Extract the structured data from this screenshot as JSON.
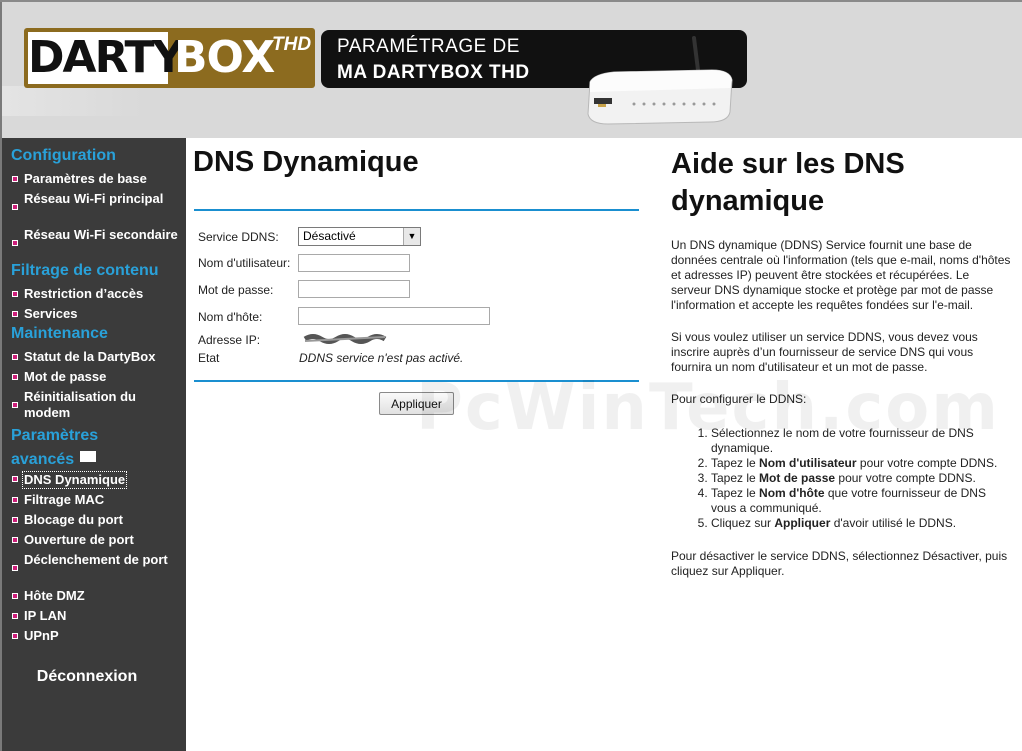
{
  "header": {
    "logo_brand": "DARTY",
    "logo_box": "BOX",
    "logo_thd": "THD",
    "banner_line1": "PARAMÉTRAGE DE",
    "banner_line2": "MA DARTYBOX THD"
  },
  "sidebar": {
    "sections": [
      {
        "title": "Configuration",
        "items": [
          "Paramètres de base",
          "Réseau Wi-Fi principal",
          "Réseau Wi-Fi secondaire"
        ]
      },
      {
        "title": "Filtrage de contenu",
        "items": [
          "Restriction d’accès",
          "Services"
        ]
      },
      {
        "title": "Maintenance",
        "items": [
          "Statut de la DartyBox",
          "Mot de passe",
          "Réinitialisation du modem"
        ]
      },
      {
        "title": "Paramètres avancés",
        "items": [
          "DNS Dynamique",
          "Filtrage MAC",
          "Blocage du port",
          "Ouverture de port",
          "Déclenchement de port",
          "Hôte DMZ",
          "IP LAN",
          "UPnP"
        ]
      }
    ],
    "active_item": "DNS Dynamique",
    "logout": "Déconnexion"
  },
  "main": {
    "title": "DNS Dynamique",
    "form": {
      "service_label": "Service DDNS:",
      "service_value": "Désactivé",
      "user_label": "Nom d'utilisateur:",
      "user_value": "",
      "pass_label": "Mot de passe:",
      "pass_value": "",
      "host_label": "Nom d'hôte:",
      "host_value": "",
      "ip_label": "Adresse IP:",
      "state_label": "Etat",
      "state_value": "DDNS service n'est pas activé.",
      "apply_button": "Appliquer"
    }
  },
  "help": {
    "title": "Aide sur les DNS dynamique",
    "p1": "Un DNS dynamique (DDNS) Service fournit une base de données centrale où l'information (tels que e-mail, noms d'hôtes et adresses IP) peuvent être stockées et récupérées. Le serveur DNS dynamique stocke et protège par mot de passe l'information et accepte les requêtes fondées sur l'e-mail.",
    "p2": "Si vous voulez utiliser un service DDNS, vous devez vous inscrire auprès d’un fournisseur de service DNS qui vous fournira un nom d'utilisateur et un mot de passe.",
    "p3": "Pour configurer le DDNS:",
    "steps": [
      {
        "pre": "Sélectionnez le nom de votre fournisseur de DNS dynamique.",
        "bold": "",
        "post": ""
      },
      {
        "pre": "Tapez le ",
        "bold": "Nom d'utilisateur",
        "post": " pour votre compte DDNS."
      },
      {
        "pre": "Tapez le ",
        "bold": "Mot de passe",
        "post": " pour votre compte DDNS."
      },
      {
        "pre": "Tapez le ",
        "bold": "Nom d'hôte",
        "post": " que votre fournisseur de DNS vous a communiqué."
      },
      {
        "pre": "Cliquez sur ",
        "bold": "Appliquer",
        "post": " d'avoir utilisé le DDNS."
      }
    ],
    "p4": "Pour désactiver le service DDNS, sélectionnez Désactiver, puis cliquez sur Appliquer."
  },
  "watermark": "PcWinTech.com",
  "colors": {
    "section": "#29a1d9",
    "sidebar_bg": "#3b3b3b",
    "bullet": "#cc1f7a",
    "rule": "#1a8fd0",
    "logo": "#8c6b1f"
  }
}
